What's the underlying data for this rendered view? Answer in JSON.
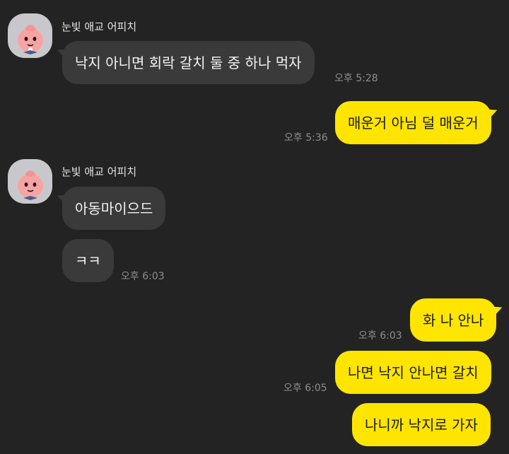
{
  "chat": {
    "partner_name": "눈빛 애교 어피치",
    "messages": [
      {
        "sender": "partner",
        "text": "낙지 아니면 회락 갈치 둘 중 하나 먹자",
        "time": "오후 5:28"
      },
      {
        "sender": "me",
        "text": "매운거 아님 덜 매운거",
        "time": "오후 5:36"
      },
      {
        "sender": "partner",
        "text": "아동마이으드",
        "time": ""
      },
      {
        "sender": "partner",
        "text": "ㅋㅋ",
        "time": "오후 6:03"
      },
      {
        "sender": "me",
        "text": "화 나 안나",
        "time": "오후 6:03"
      },
      {
        "sender": "me",
        "text": "나면 낙지 안나면 갈치",
        "time": "오후 6:05"
      },
      {
        "sender": "me",
        "text": "나니까 낙지로 가자",
        "time": ""
      }
    ]
  },
  "colors": {
    "background": "#232323",
    "incoming_bubble": "#3a3a3b",
    "outgoing_bubble": "#fee500",
    "timestamp": "#8e8e8e"
  },
  "icons": {
    "avatar": "apeach-profile-icon"
  }
}
